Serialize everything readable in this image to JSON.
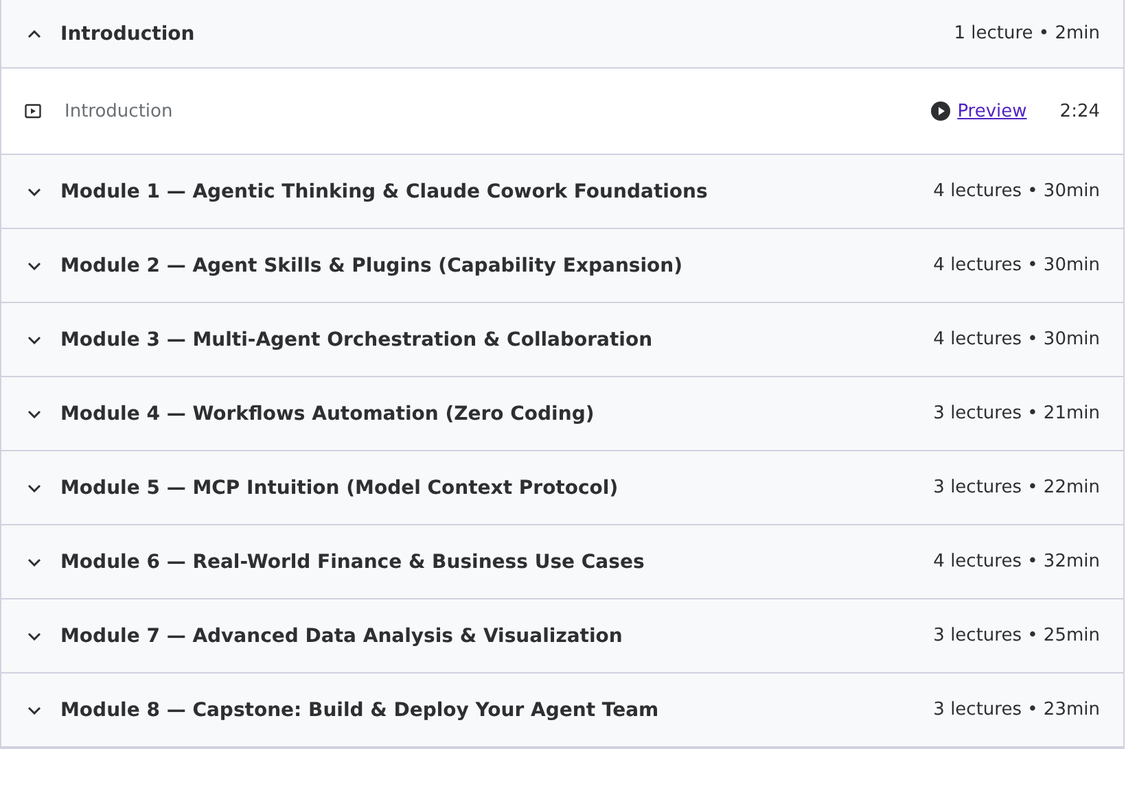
{
  "sections": [
    {
      "title": "Introduction",
      "meta": "1 lecture • 2min",
      "expanded": true,
      "lectures": [
        {
          "title": "Introduction",
          "preview": "Preview",
          "duration": "2:24"
        }
      ]
    },
    {
      "title": "Module 1 — Agentic Thinking & Claude Cowork Foundations",
      "meta": "4 lectures • 30min",
      "expanded": false
    },
    {
      "title": "Module 2 — Agent Skills & Plugins (Capability Expansion)",
      "meta": "4 lectures • 30min",
      "expanded": false
    },
    {
      "title": "Module 3 — Multi-Agent Orchestration & Collaboration",
      "meta": "4 lectures • 30min",
      "expanded": false
    },
    {
      "title": "Module 4 — Workflows Automation (Zero Coding)",
      "meta": "3 lectures • 21min",
      "expanded": false
    },
    {
      "title": "Module 5 — MCP Intuition (Model Context Protocol)",
      "meta": "3 lectures • 22min",
      "expanded": false
    },
    {
      "title": "Module 6 — Real-World Finance & Business Use Cases",
      "meta": "4 lectures • 32min",
      "expanded": false
    },
    {
      "title": "Module 7 — Advanced Data Analysis & Visualization",
      "meta": "3 lectures • 25min",
      "expanded": false
    },
    {
      "title": "Module 8 — Capstone: Build & Deploy Your Agent Team",
      "meta": "3 lectures • 23min",
      "expanded": false
    }
  ]
}
